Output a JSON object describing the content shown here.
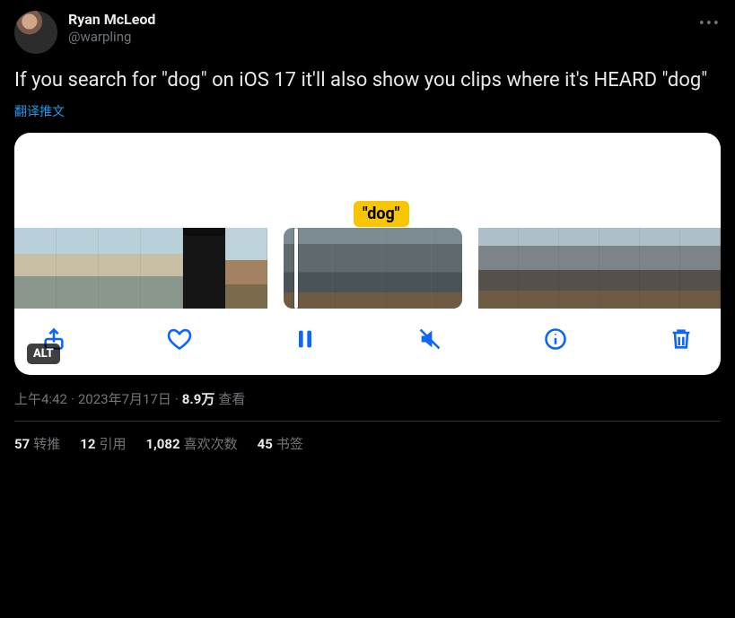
{
  "author": {
    "display_name": "Ryan McLeod",
    "handle": "@warpling"
  },
  "tweet_text": "If you search for \"dog\" on iOS 17 it'll also show you clips where it's HEARD \"dog\"",
  "translate_label": "翻译推文",
  "media": {
    "search_tag": "\"dog\"",
    "alt_badge": "ALT"
  },
  "meta": {
    "time": "上午4:42",
    "date": "2023年7月17日",
    "views_count": "8.9万",
    "views_label": "查看"
  },
  "stats": {
    "retweets_count": "57",
    "retweets_label": "转推",
    "quotes_count": "12",
    "quotes_label": "引用",
    "likes_count": "1,082",
    "likes_label": "喜欢次数",
    "bookmarks_count": "45",
    "bookmarks_label": "书签"
  }
}
